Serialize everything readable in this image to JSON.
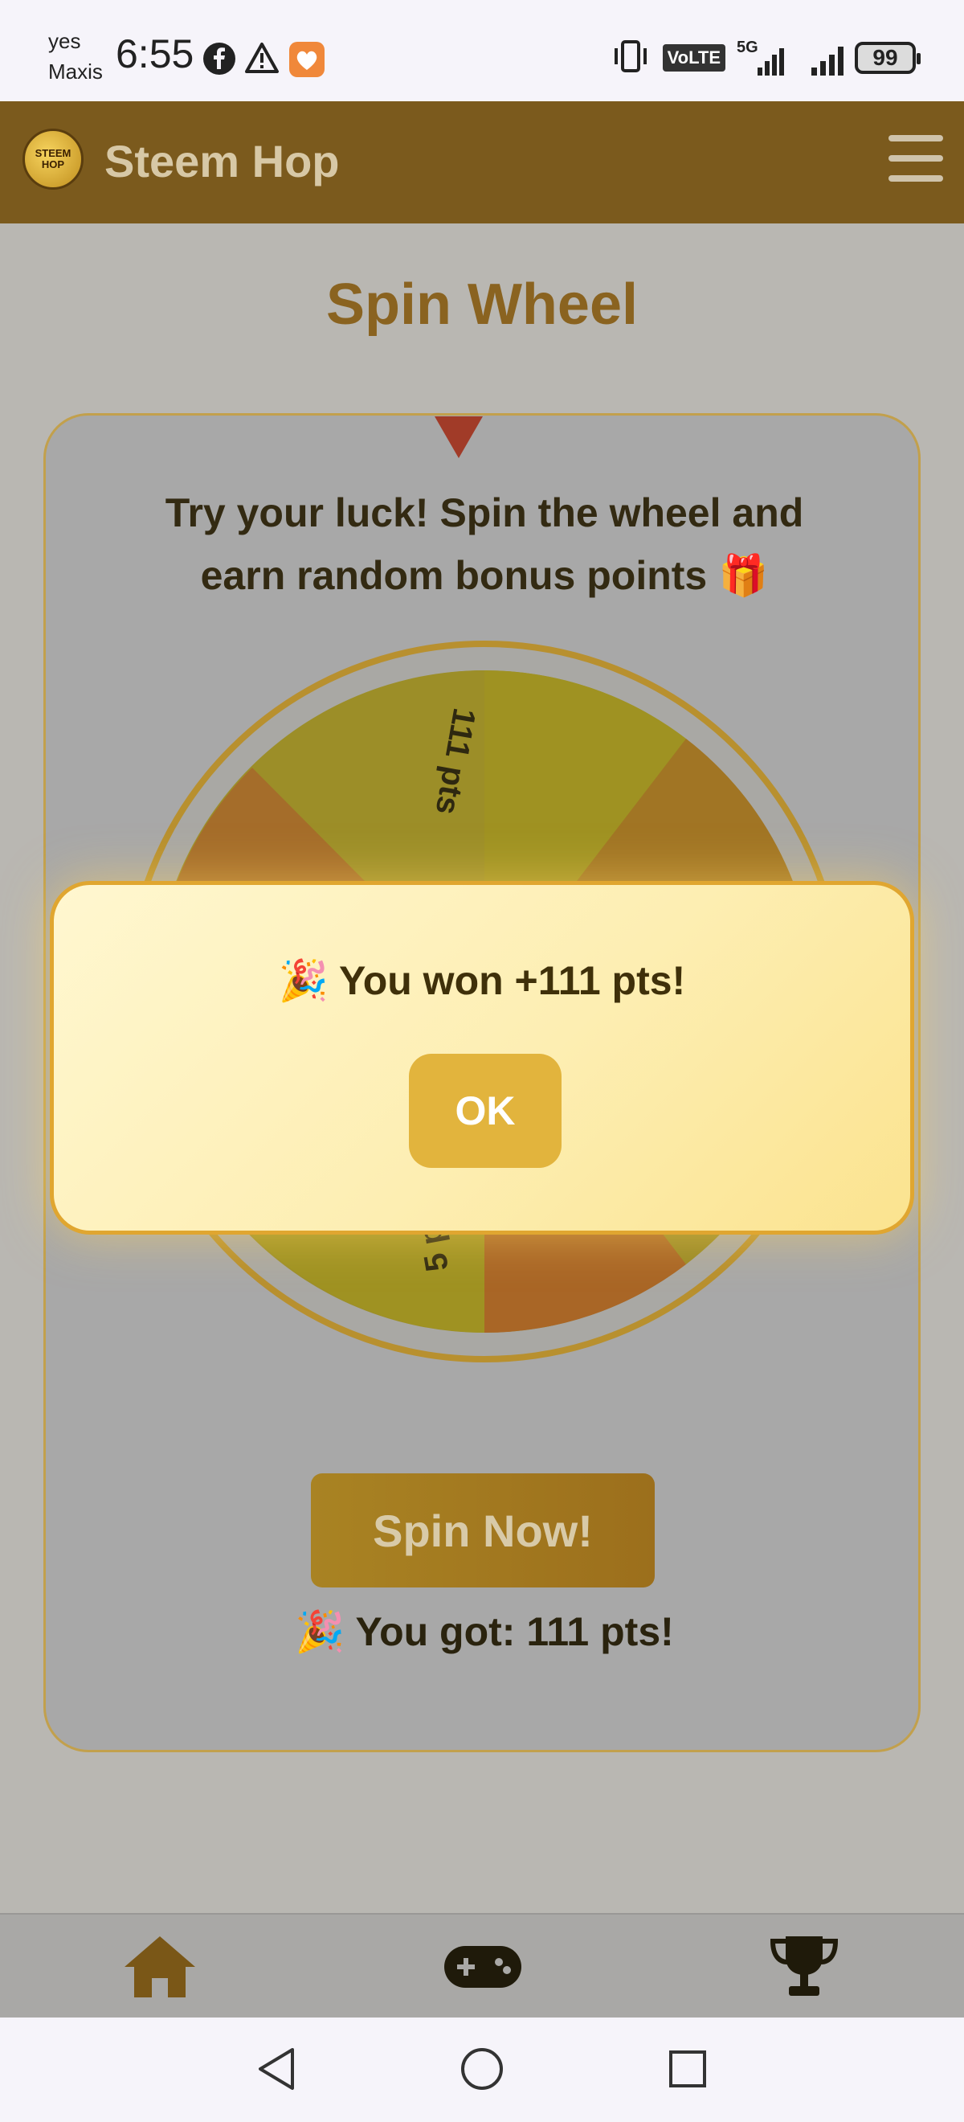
{
  "status_bar": {
    "carrier_line1": "yes",
    "carrier_line2": "Maxis",
    "time": "6:55",
    "icons": [
      "facebook-icon",
      "warning-icon",
      "heart-app-icon",
      "vibrate-icon",
      "volte-icon",
      "signal-icon",
      "signal-icon"
    ],
    "volte_label": "VoLTE",
    "network_label": "5G",
    "battery_level": "99"
  },
  "header": {
    "logo_text": "STEEM HOP",
    "brand": "Steem Hop",
    "menu_icon": "hamburger-icon"
  },
  "page": {
    "title": "Spin Wheel",
    "intro": "Try your luck! Spin the wheel and earn random bonus points 🎁",
    "wheel": {
      "labels": [
        "111 pts",
        "5 pts"
      ],
      "colors": {
        "rim": "#b8902f",
        "segment_a": "#9f9222",
        "segment_b": "#a17524",
        "segment_c": "#a96626",
        "segment_d": "#9a8a26"
      }
    },
    "spin_button": "Spin Now!",
    "result": "🎉 You got: 111 pts!"
  },
  "modal": {
    "message": "🎉 You won +111 pts!",
    "ok_label": "OK"
  },
  "bottom_nav": {
    "items": [
      {
        "name": "home",
        "icon": "home-icon"
      },
      {
        "name": "games",
        "icon": "gamepad-icon"
      },
      {
        "name": "leaderboard",
        "icon": "trophy-icon"
      }
    ]
  },
  "system_nav": {
    "items": [
      "back-icon",
      "home-circle-icon",
      "recents-icon"
    ]
  },
  "colors": {
    "header_bg": "#7b5a1d",
    "accent_gold": "#e2b43d",
    "modal_border": "#e0a630",
    "title_brown": "#8a6320"
  }
}
